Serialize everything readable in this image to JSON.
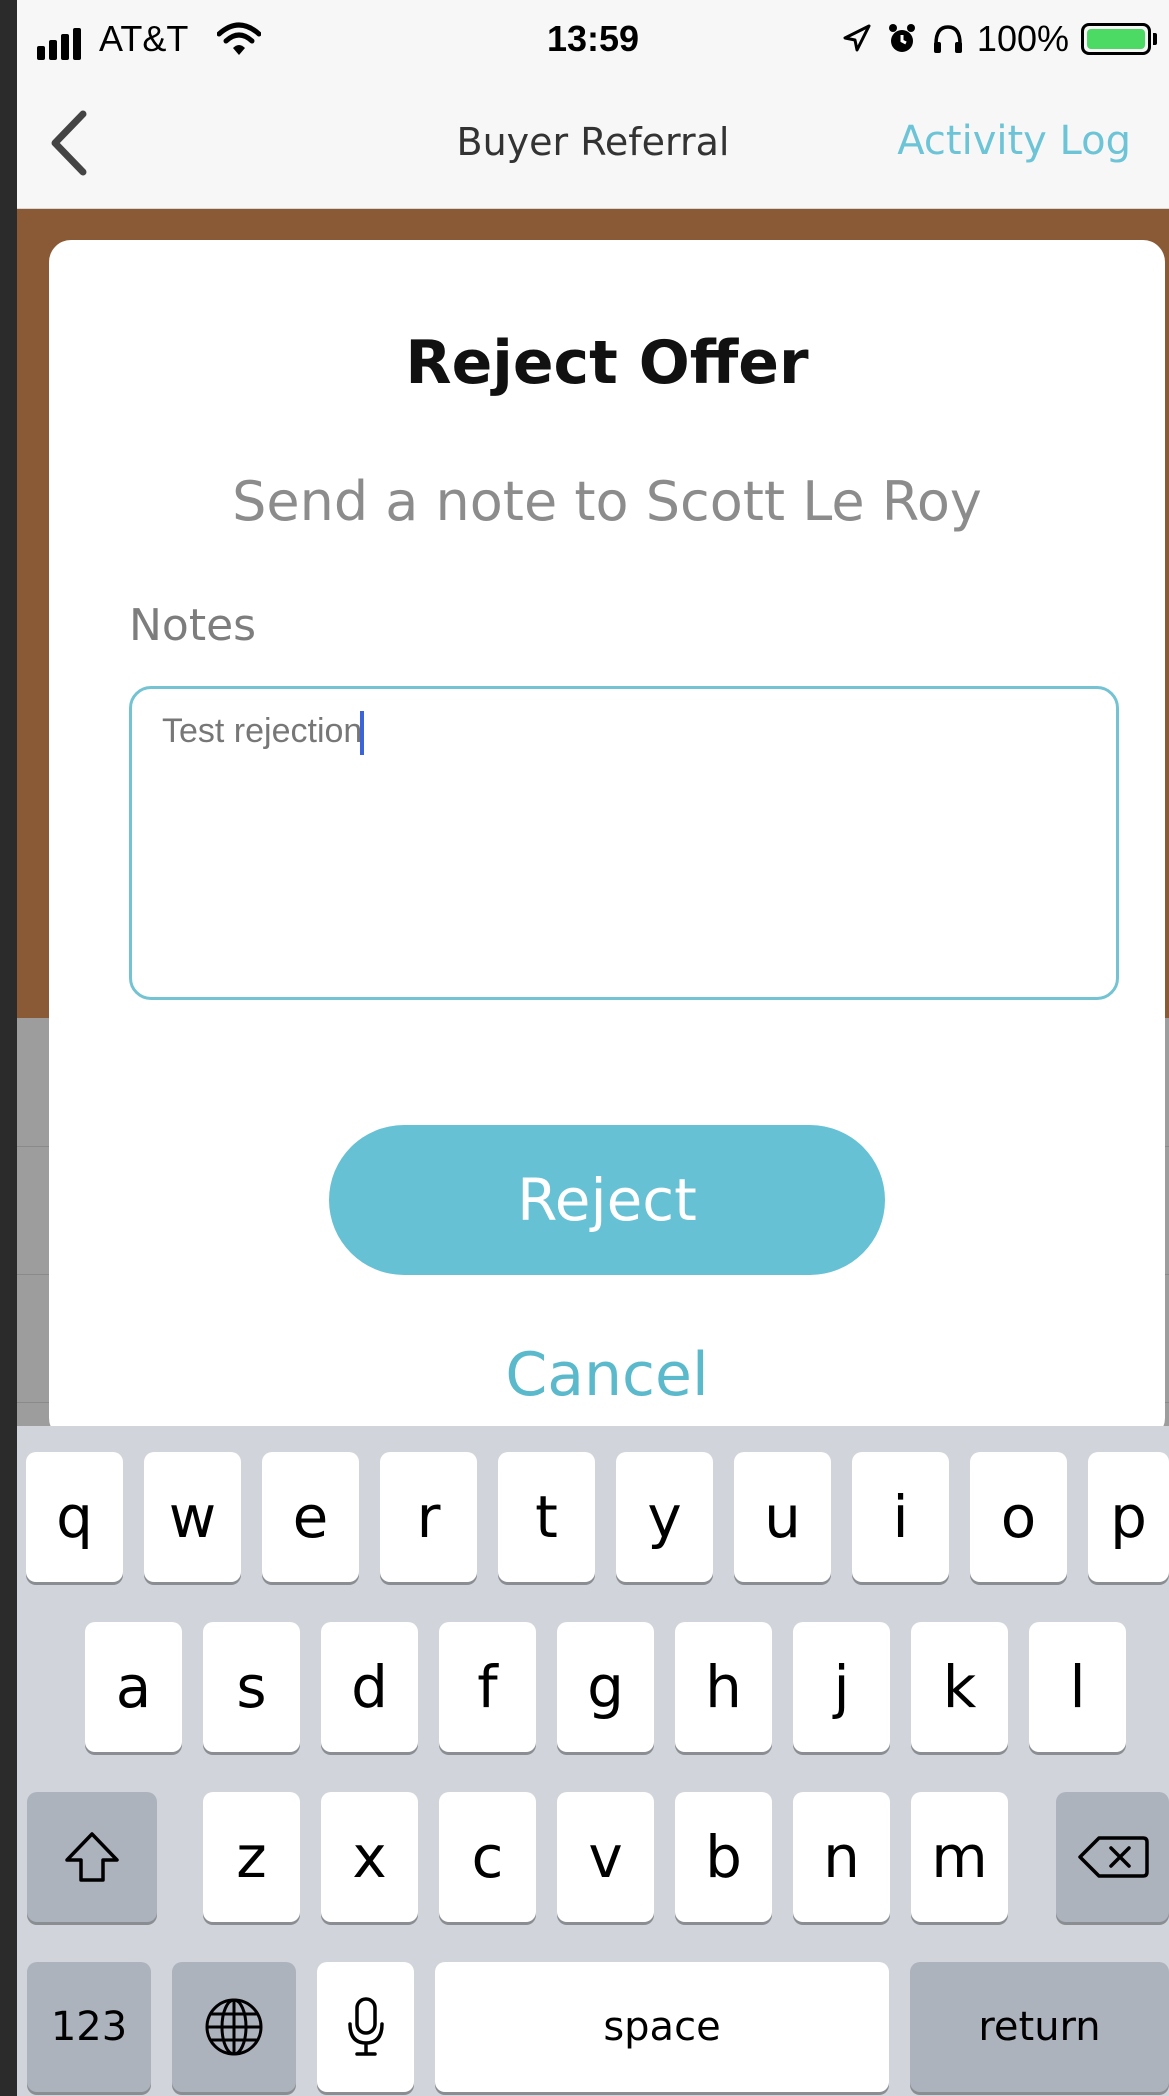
{
  "status_bar": {
    "carrier": "AT&T",
    "time": "13:59",
    "battery": "100%",
    "icons": [
      "signal-icon",
      "wifi-icon",
      "location-arrow-icon",
      "alarm-icon",
      "headphones-icon",
      "battery-icon"
    ]
  },
  "nav": {
    "back_icon": "chevron-left-icon",
    "title": "Buyer Referral",
    "action": "Activity Log"
  },
  "modal": {
    "title": "Reject Offer",
    "subtitle": "Send a note to Scott Le Roy",
    "notes_label": "Notes",
    "notes_value": "Test rejection",
    "reject_label": "Reject",
    "cancel_label": "Cancel"
  },
  "keyboard": {
    "row1": [
      "q",
      "w",
      "e",
      "r",
      "t",
      "y",
      "u",
      "i",
      "o",
      "p"
    ],
    "row2": [
      "a",
      "s",
      "d",
      "f",
      "g",
      "h",
      "j",
      "k",
      "l"
    ],
    "row3": [
      "z",
      "x",
      "c",
      "v",
      "b",
      "n",
      "m"
    ],
    "numbers": "123",
    "space": "space",
    "return": "return",
    "shift_icon": "shift-icon",
    "delete_icon": "delete-icon",
    "globe_icon": "globe-icon",
    "mic_icon": "microphone-icon"
  },
  "colors": {
    "accent": "#66c1d4",
    "link": "#5bb9cc",
    "background": "#8a5a36",
    "battery_fill": "#4cd964"
  }
}
